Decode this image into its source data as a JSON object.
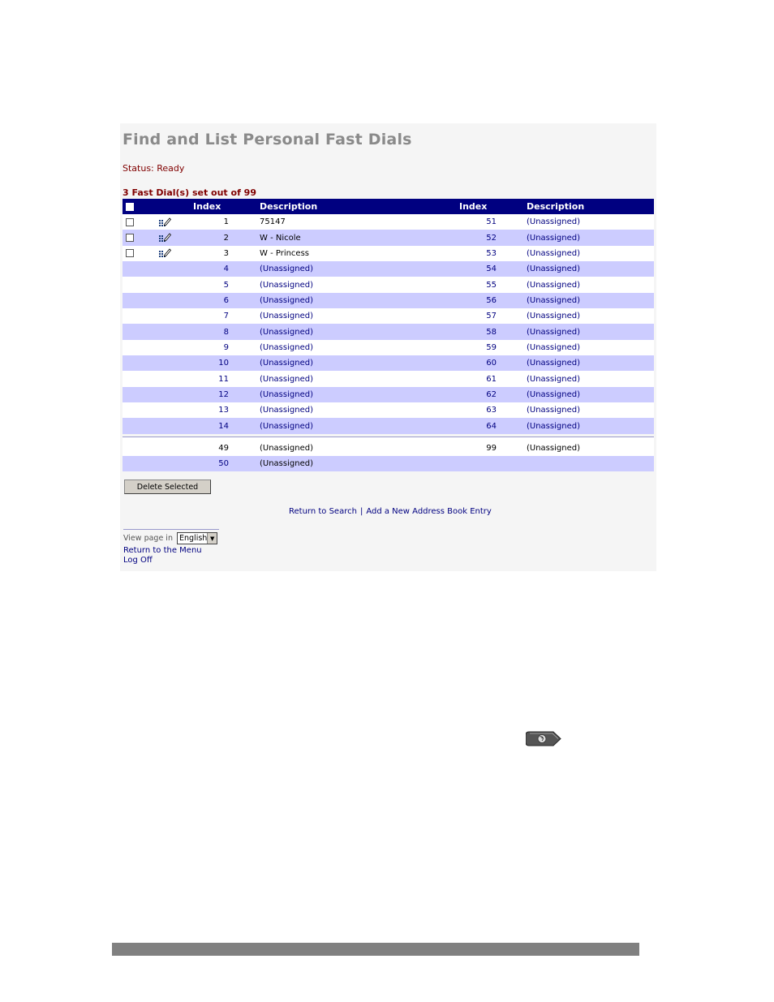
{
  "page": {
    "title": "Find and List Personal Fast Dials",
    "status": "Status: Ready",
    "count": "3 Fast Dial(s) set out of 99"
  },
  "table": {
    "headers": {
      "index1": "Index",
      "description1": "Description",
      "index2": "Index",
      "description2": "Description"
    },
    "rows": [
      {
        "i1": "1",
        "d1": "75147",
        "i2": "51",
        "d2": "(Unassigned)",
        "assigned": true
      },
      {
        "i1": "2",
        "d1": "W - Nicole",
        "i2": "52",
        "d2": "(Unassigned)",
        "assigned": true
      },
      {
        "i1": "3",
        "d1": "W - Princess",
        "i2": "53",
        "d2": "(Unassigned)",
        "assigned": true
      },
      {
        "i1": "4",
        "d1": "(Unassigned)",
        "i2": "54",
        "d2": "(Unassigned)",
        "assigned": false
      },
      {
        "i1": "5",
        "d1": "(Unassigned)",
        "i2": "55",
        "d2": "(Unassigned)",
        "assigned": false
      },
      {
        "i1": "6",
        "d1": "(Unassigned)",
        "i2": "56",
        "d2": "(Unassigned)",
        "assigned": false
      },
      {
        "i1": "7",
        "d1": "(Unassigned)",
        "i2": "57",
        "d2": "(Unassigned)",
        "assigned": false
      },
      {
        "i1": "8",
        "d1": "(Unassigned)",
        "i2": "58",
        "d2": "(Unassigned)",
        "assigned": false
      },
      {
        "i1": "9",
        "d1": "(Unassigned)",
        "i2": "59",
        "d2": "(Unassigned)",
        "assigned": false
      },
      {
        "i1": "10",
        "d1": "(Unassigned)",
        "i2": "60",
        "d2": "(Unassigned)",
        "assigned": false
      },
      {
        "i1": "11",
        "d1": "(Unassigned)",
        "i2": "61",
        "d2": "(Unassigned)",
        "assigned": false
      },
      {
        "i1": "12",
        "d1": "(Unassigned)",
        "i2": "62",
        "d2": "(Unassigned)",
        "assigned": false
      },
      {
        "i1": "13",
        "d1": "(Unassigned)",
        "i2": "63",
        "d2": "(Unassigned)",
        "assigned": false
      },
      {
        "i1": "14",
        "d1": "(Unassigned)",
        "i2": "64",
        "d2": "(Unassigned)",
        "assigned": false
      }
    ],
    "tail_rows": [
      {
        "i1": "49",
        "d1": "(Unassigned)",
        "i2": "99",
        "d2": "(Unassigned)"
      },
      {
        "i1": "50",
        "d1": "(Unassigned)",
        "i2": "",
        "d2": ""
      }
    ]
  },
  "actions": {
    "delete_label": "Delete Selected",
    "return_search": "Return to Search",
    "divider": "|",
    "add_entry": "Add a New Address Book Entry"
  },
  "footer": {
    "view_label": "View page in",
    "language": "English",
    "return_menu": "Return to the Menu",
    "logoff": "Log Off"
  },
  "icons": {
    "edit": "edit-pencil-icon",
    "globe": "globe-button-icon"
  },
  "colors": {
    "header_bg": "#000080",
    "row_alt": "#ccccff",
    "title": "#8a8a8a",
    "status": "#800000",
    "link": "#000080"
  }
}
